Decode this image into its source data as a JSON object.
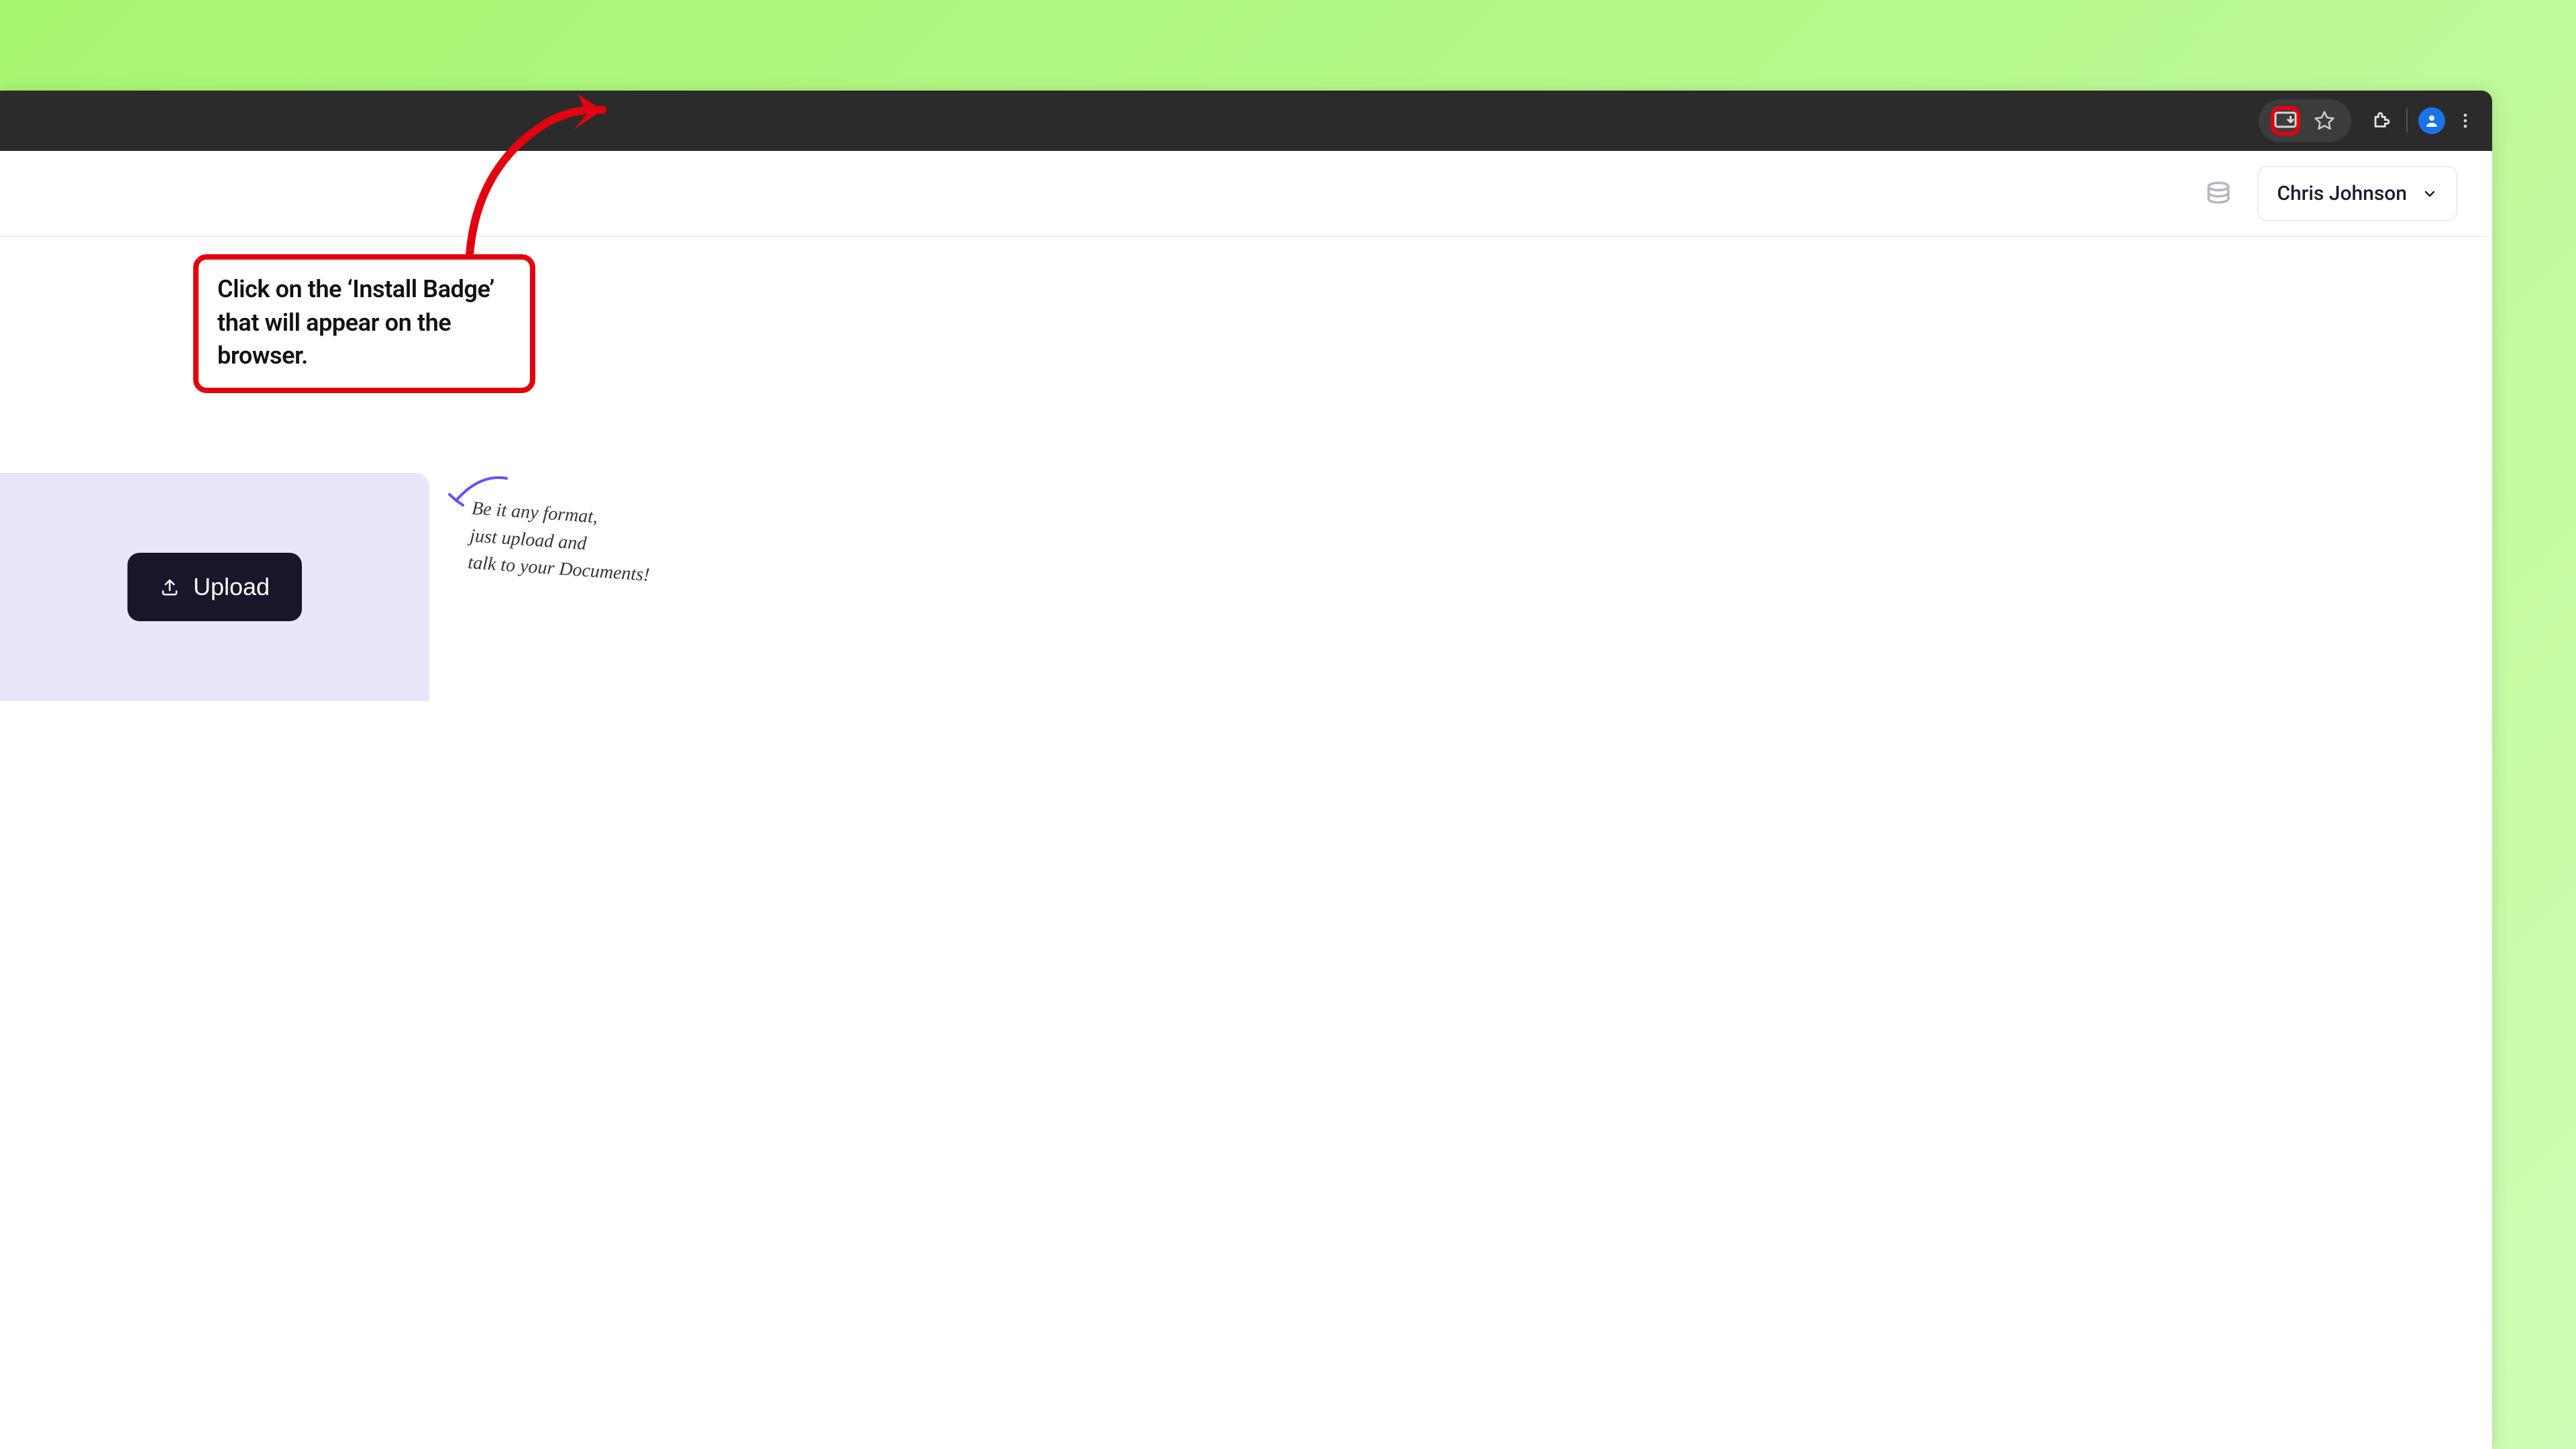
{
  "browser": {
    "icons": {
      "install": "install-app-icon",
      "bookmark": "star-icon",
      "extensions": "puzzle-icon",
      "profile": "profile-icon",
      "menu": "kebab-menu-icon"
    }
  },
  "app_bar": {
    "credits_icon": "coins-icon",
    "user_name": "Chris Johnson"
  },
  "callout": {
    "text": "Click on the ‘Install Badge’ that will appear on the browser."
  },
  "upload": {
    "label": "Upload"
  },
  "handwritten_note": {
    "line1": "Be it any format,",
    "line2": "just upload and",
    "line3": "talk to your Documents!"
  },
  "colors": {
    "annotation_red": "#e3000f",
    "accent_purple": "#6a4cff",
    "bg_gradient_start": "#a6f570",
    "chrome_dark": "#2b2b2b"
  }
}
